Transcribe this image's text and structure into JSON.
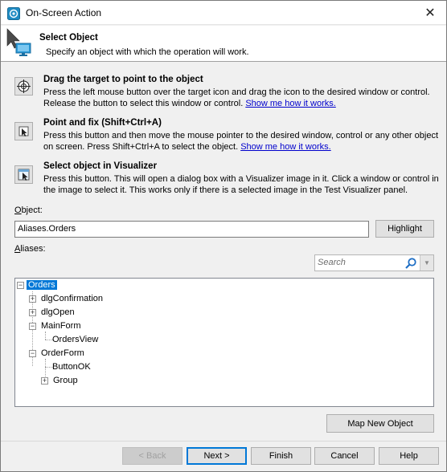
{
  "window": {
    "title": "On-Screen Action",
    "close_glyph": "✕"
  },
  "header": {
    "title": "Select Object",
    "subtitle": "Specify an object with which the operation will work."
  },
  "methods": [
    {
      "icon": "target-crosshair-icon",
      "title": "Drag the target to point to the object",
      "desc": "Press the left mouse button over the target icon and drag the icon to the desired window or control. Release the button to select this window or control.",
      "link": "Show me how it works."
    },
    {
      "icon": "point-fix-icon",
      "title": "Point and fix (Shift+Ctrl+A)",
      "desc": "Press this button and then move the mouse pointer to the desired window, control or any other object on screen. Press Shift+Ctrl+A to select the object.",
      "link": "Show me how it works."
    },
    {
      "icon": "visualizer-icon",
      "title": "Select object in Visualizer",
      "desc": "Press this button. This will open a dialog box with a Visualizer image in it. Click a window or control in the image to select it. This works only if there is a selected image in the Test Visualizer panel.",
      "link": ""
    }
  ],
  "object": {
    "label": "Object:",
    "value": "Aliases.Orders",
    "highlight_label": "Highlight"
  },
  "aliases": {
    "label": "Aliases:",
    "search_placeholder": "Search",
    "tree": [
      {
        "label": "Orders",
        "level": 0,
        "expander": "−",
        "selected": true
      },
      {
        "label": "dlgConfirmation",
        "level": 1,
        "expander": "+"
      },
      {
        "label": "dlgOpen",
        "level": 1,
        "expander": "+"
      },
      {
        "label": "MainForm",
        "level": 1,
        "expander": "−"
      },
      {
        "label": "OrdersView",
        "level": 2,
        "expander": ""
      },
      {
        "label": "OrderForm",
        "level": 1,
        "expander": "−"
      },
      {
        "label": "ButtonOK",
        "level": 2,
        "expander": ""
      },
      {
        "label": "Group",
        "level": 2,
        "expander": "+"
      }
    ]
  },
  "map_button": "Map New Object",
  "footer": {
    "back": "< Back",
    "next": "Next >",
    "finish": "Finish",
    "cancel": "Cancel",
    "help": "Help"
  },
  "colors": {
    "selection": "#0078d7",
    "link": "#0000cc",
    "default_border": "#0078d7"
  }
}
